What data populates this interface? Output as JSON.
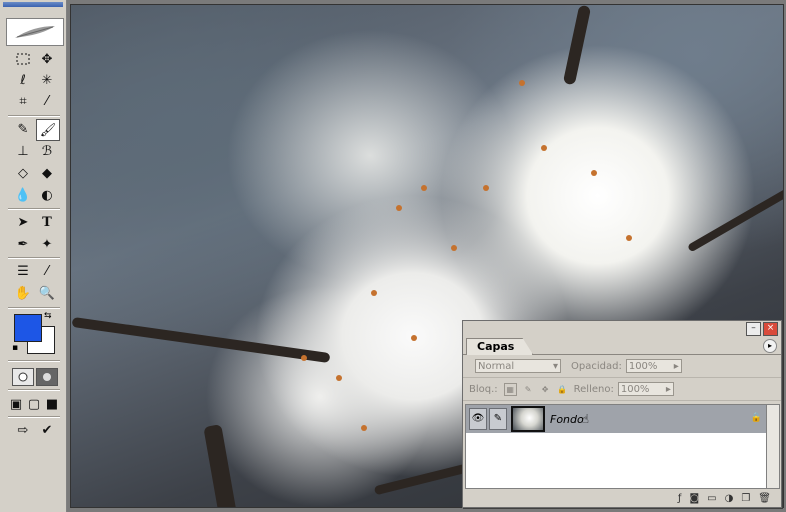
{
  "palette": {
    "tab": "Capas",
    "blend_mode": "Normal",
    "opacity_label": "Opacidad:",
    "opacity_value": "100%",
    "lock_label": "Bloq.:",
    "fill_label": "Relleno:",
    "fill_value": "100%",
    "layer_name": "Fondo"
  },
  "colors": {
    "foreground": "#1d56e6",
    "background": "#ffffff"
  }
}
